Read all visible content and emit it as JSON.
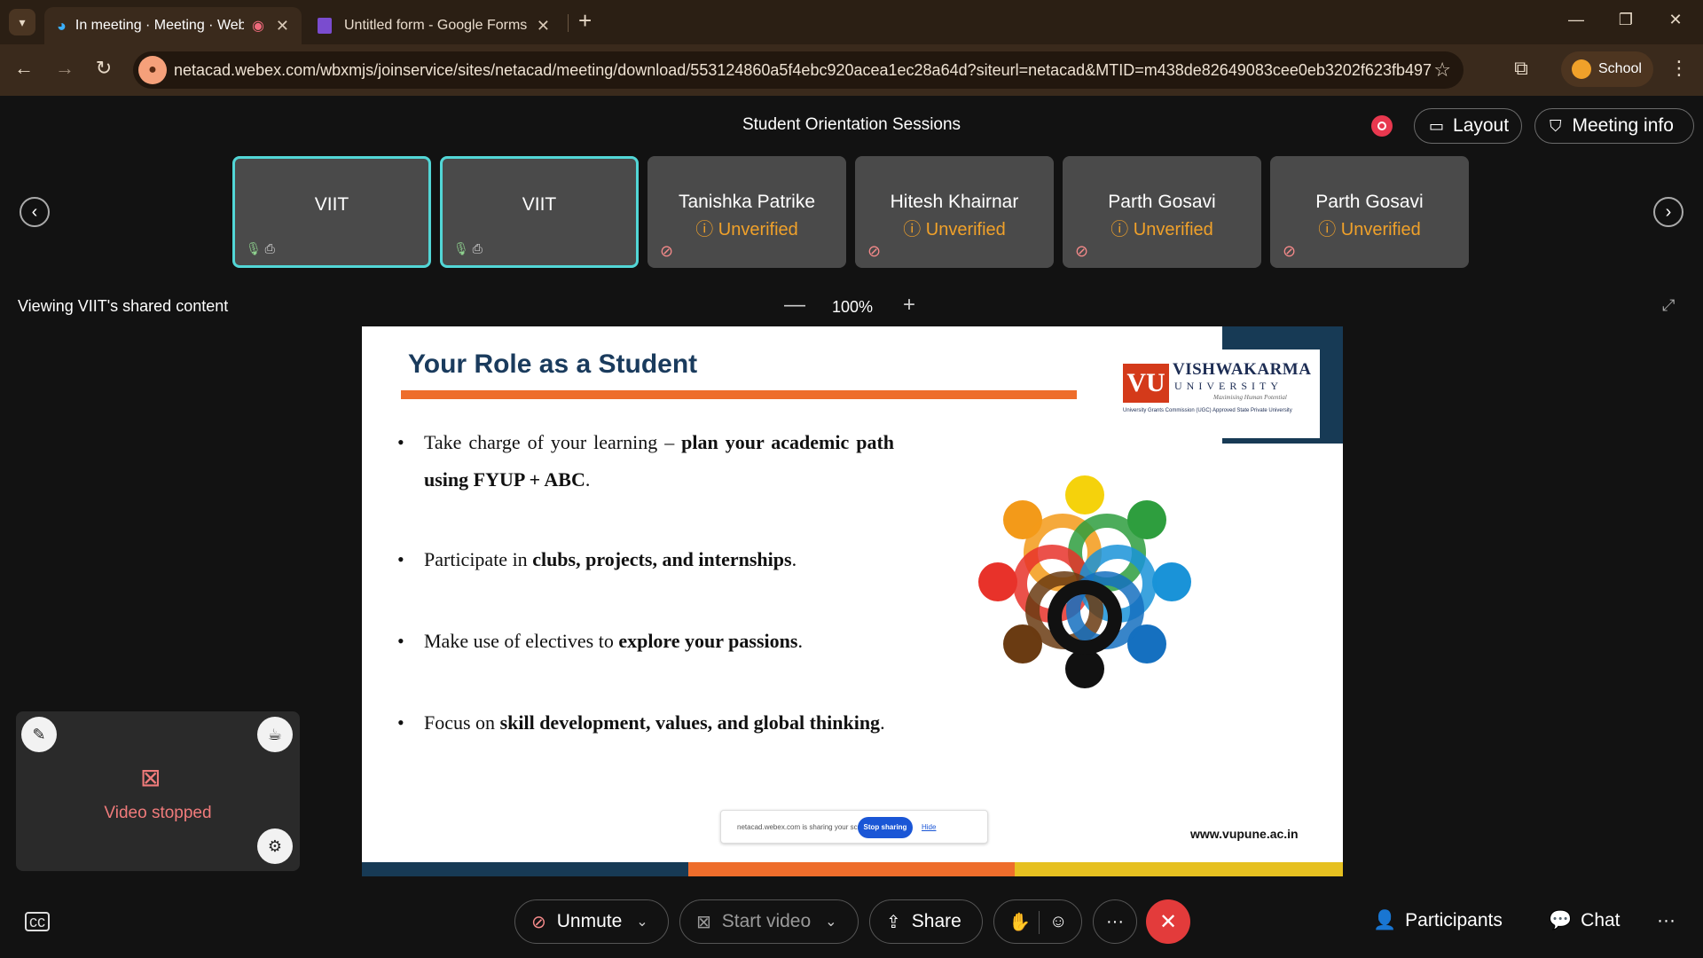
{
  "browser": {
    "tabs": [
      {
        "title": "In meeting · Meeting · Webex",
        "active": true
      },
      {
        "title": "Untitled form - Google Forms",
        "active": false
      }
    ],
    "new_tab": "+",
    "url": "netacad.webex.com/wbxmjs/joinservice/sites/netacad/meeting/download/553124860a5f4ebc920acea1ec28a64d?siteurl=netacad&MTID=m438de82649083cee0eb3202f623fb497",
    "profile_label": "School",
    "colors": {
      "tabbar": "#2b1f14",
      "toolbar": "#3a2a1c",
      "profile": "#f0a12a"
    }
  },
  "meeting": {
    "title": "Student Orientation Sessions",
    "layout_label": "Layout",
    "info_label": "Meeting info",
    "participants": [
      {
        "name": "VIIT",
        "status": "",
        "speaking": true
      },
      {
        "name": "VIIT",
        "status": "",
        "speaking": true
      },
      {
        "name": "Tanishka Patrike",
        "status": "Unverified",
        "speaking": false
      },
      {
        "name": "Hitesh Khairnar",
        "status": "Unverified",
        "speaking": false
      },
      {
        "name": "Parth Gosavi",
        "status": "Unverified",
        "speaking": false
      },
      {
        "name": "Parth Gosavi",
        "status": "Unverified",
        "speaking": false
      }
    ],
    "viewing_label": "Viewing VIIT's shared content",
    "zoom": "100%"
  },
  "slide": {
    "title": "Your Role as a Student",
    "logo": {
      "mark": "VU",
      "name": "VISHWAKARMA",
      "sub": "UNIVERSITY",
      "tagline": "Maximising Human Potential",
      "ugc": "University Grants Commission (UGC) Approved State Private University"
    },
    "bullets": [
      {
        "plain": "Take charge of your learning – ",
        "bold": "plan your academic path using FYUP + ABC",
        "end": "."
      },
      {
        "plain": "Participate in ",
        "bold": "clubs, projects, and internships",
        "end": "."
      },
      {
        "plain": "Make use of electives to ",
        "bold": "explore your passions",
        "end": "."
      },
      {
        "plain": "Focus on ",
        "bold": "skill development, values, and global thinking",
        "end": "."
      }
    ],
    "website": "www.vupune.ac.in",
    "share_notice": {
      "text": "netacad.webex.com is sharing your screen.",
      "stop": "Stop sharing",
      "hide": "Hide"
    },
    "colors": {
      "title": "#1a3b5d",
      "rule": "#ee6d2b",
      "stripe_blue": "#173a55",
      "stripe_orange": "#ee6d2b",
      "stripe_yellow": "#e6c020"
    }
  },
  "selfview": {
    "label": "Video stopped"
  },
  "controls": {
    "unmute": "Unmute",
    "start_video": "Start video",
    "share": "Share",
    "participants": "Participants",
    "chat": "Chat",
    "more": "···"
  }
}
